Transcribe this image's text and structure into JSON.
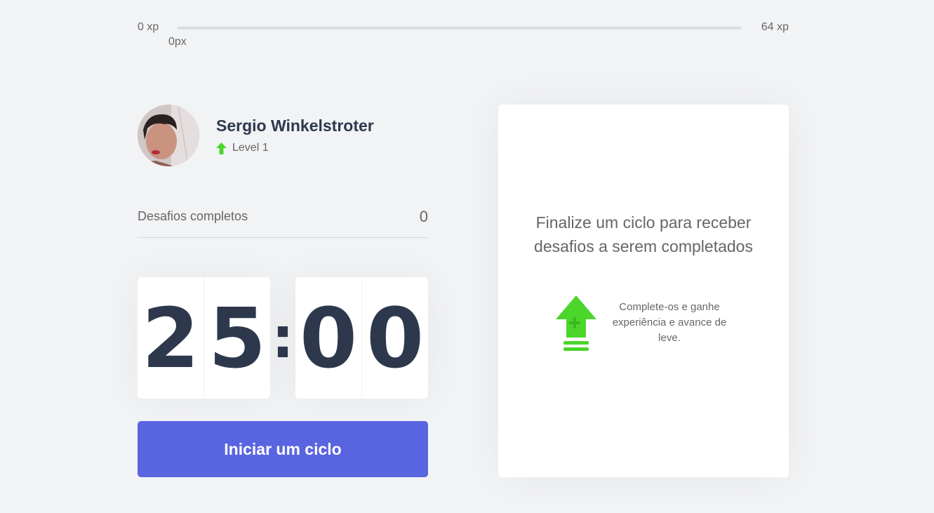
{
  "experience": {
    "min_label": "0 xp",
    "max_label": "64 xp",
    "current_label": "0px",
    "progress_fraction": 0
  },
  "profile": {
    "name": "Sergio Winkelstroter",
    "level_label": "Level 1"
  },
  "completed_challenges": {
    "label": "Desafios completos",
    "count": "0"
  },
  "countdown": {
    "minute_left": "2",
    "minute_right": "5",
    "separator": ":",
    "second_left": "0",
    "second_right": "0"
  },
  "cycle_button": {
    "label": "Iniciar um ciclo"
  },
  "challenge_box": {
    "title": "Finalize um ciclo para receber desafios a serem completados",
    "hint": "Complete-os e ganhe experiência e avance de leve.",
    "icon": "level-up-icon"
  },
  "colors": {
    "accent_green": "#4cd62b",
    "button_blue": "#5965e0",
    "title_dark": "#2e384d",
    "background": "#f2f3f5"
  }
}
